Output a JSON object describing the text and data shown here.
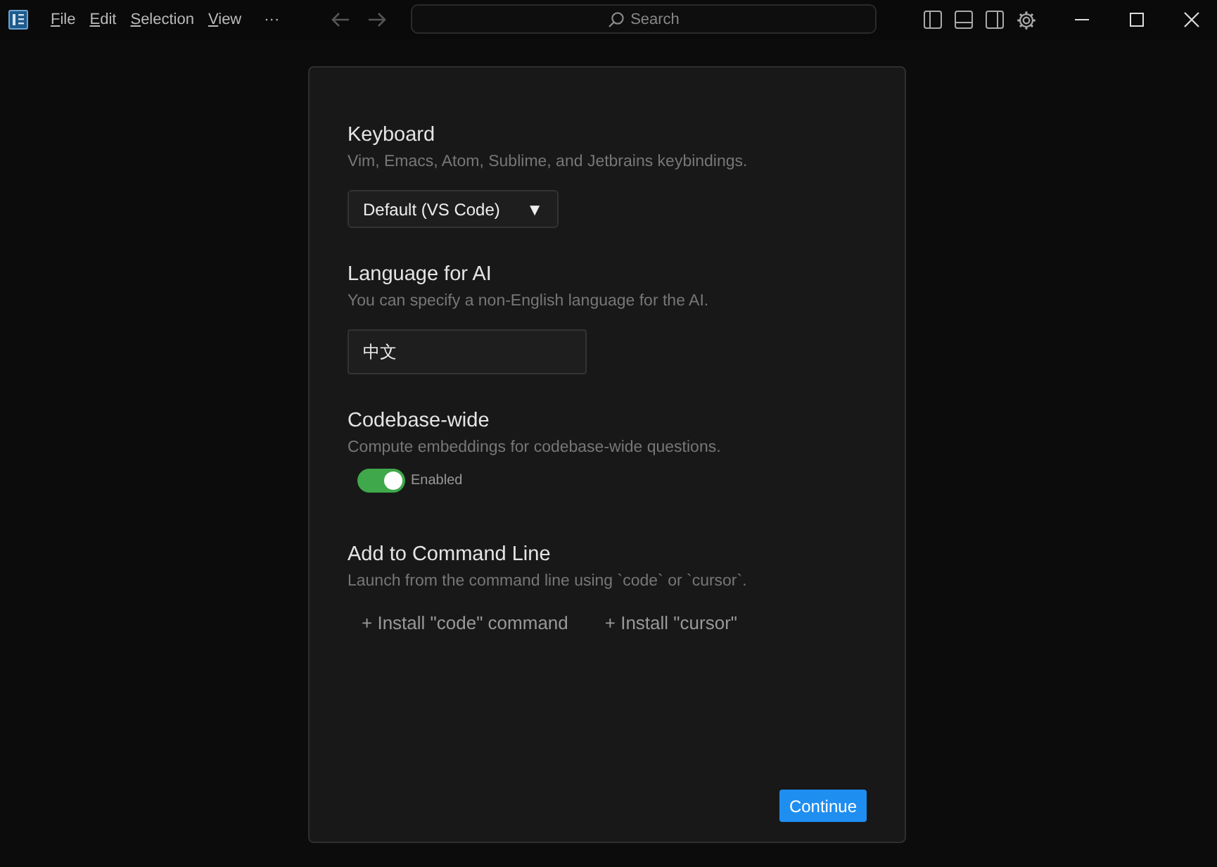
{
  "menu": [
    "File",
    "Edit",
    "Selection",
    "View",
    "···"
  ],
  "search": {
    "placeholder": "Search"
  },
  "sections": [
    {
      "kind": "select",
      "title": "Keyboard",
      "description": "Vim, Emacs, Atom, Sublime, and Jetbrains keybindings.",
      "value": "Default (VS Code)",
      "caret": "▼"
    },
    {
      "kind": "input",
      "title": "Language for AI",
      "description": "You can specify a non-English language for the AI.",
      "value": "中文"
    },
    {
      "kind": "toggle",
      "title": "Codebase-wide",
      "description": "Compute embeddings for codebase-wide questions.",
      "on": true,
      "label": "Enabled"
    },
    {
      "kind": "buttons",
      "title": "Add to Command Line",
      "description": "Launch from the command line using `code` or `cursor`.",
      "buttons": [
        "+ Install \"code\" command",
        "+ Install \"cursor\""
      ]
    }
  ],
  "continue_button": "Continue"
}
